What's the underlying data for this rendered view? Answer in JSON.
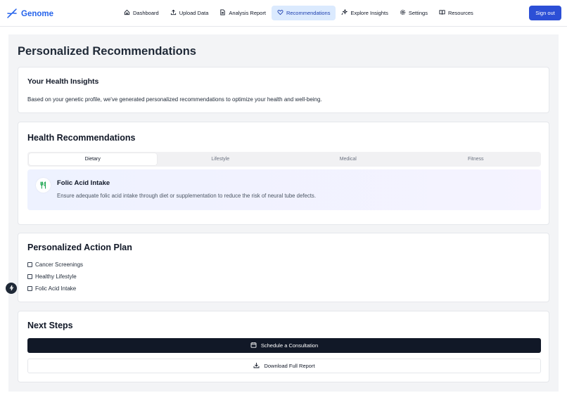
{
  "brand": {
    "name": "Genome",
    "color": "#2563eb"
  },
  "nav": {
    "items": [
      {
        "label": "Dashboard",
        "icon": "home-icon",
        "active": false
      },
      {
        "label": "Upload Data",
        "icon": "upload-icon",
        "active": false
      },
      {
        "label": "Analysis Report",
        "icon": "file-text-icon",
        "active": false
      },
      {
        "label": "Recommendations",
        "icon": "heart-icon",
        "active": true
      },
      {
        "label": "Explore Insights",
        "icon": "sparkles-icon",
        "active": false
      },
      {
        "label": "Settings",
        "icon": "gear-icon",
        "active": false
      },
      {
        "label": "Resources",
        "icon": "book-icon",
        "active": false
      }
    ],
    "sign_out": "Sign out"
  },
  "page": {
    "title": "Personalized Recommendations"
  },
  "insights": {
    "title": "Your Health Insights",
    "text": "Based on your genetic profile, we've generated personalized recommendations to optimize your health and well-being."
  },
  "health_recommendations": {
    "title": "Health Recommendations",
    "tabs": [
      {
        "label": "Dietary",
        "active": true
      },
      {
        "label": "Lifestyle",
        "active": false
      },
      {
        "label": "Medical",
        "active": false
      },
      {
        "label": "Fitness",
        "active": false
      }
    ],
    "item": {
      "icon": "utensils-icon",
      "title": "Folic Acid Intake",
      "description": "Ensure adequate folic acid intake through diet or supplementation to reduce the risk of neural tube defects."
    }
  },
  "action_plan": {
    "title": "Personalized Action Plan",
    "items": [
      {
        "label": "Cancer Screenings",
        "checked": false
      },
      {
        "label": "Healthy Lifestyle",
        "checked": false
      },
      {
        "label": "Folic Acid Intake",
        "checked": false
      }
    ]
  },
  "next_steps": {
    "title": "Next Steps",
    "primary_button": "Schedule a Consultation",
    "secondary_button": "Download Full Report"
  },
  "colors": {
    "accent": "#2c4fd6",
    "active_nav_bg": "#dbeafe",
    "dark_button": "#111827",
    "icon_green": "#16a34a"
  }
}
